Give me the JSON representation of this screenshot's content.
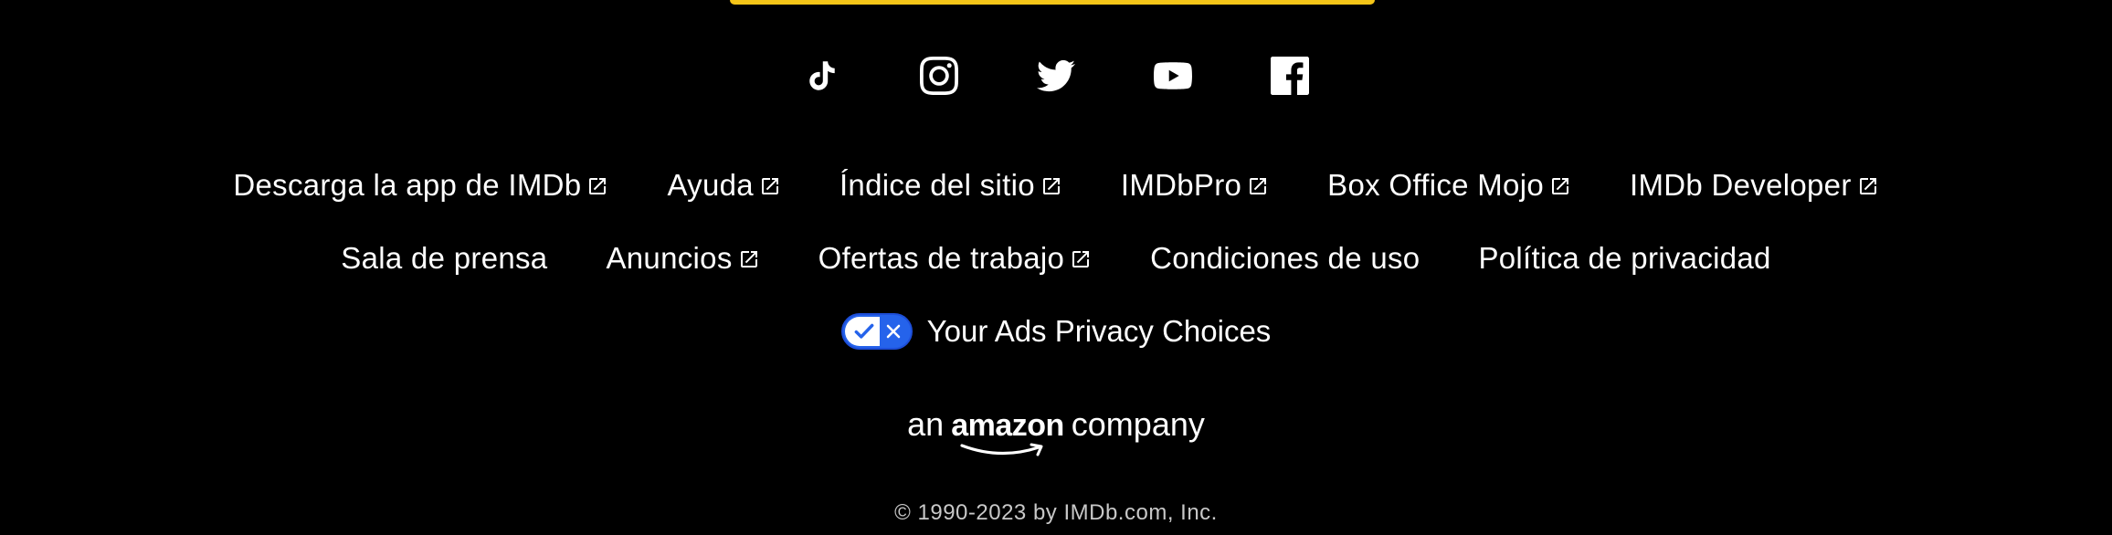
{
  "accent_color": "#f5c518",
  "privacy_toggle_color": "#2563eb",
  "social": [
    {
      "name": "tiktok-icon"
    },
    {
      "name": "instagram-icon"
    },
    {
      "name": "twitter-icon"
    },
    {
      "name": "youtube-icon"
    },
    {
      "name": "facebook-icon"
    }
  ],
  "links_row1": [
    {
      "label": "Descarga la app de IMDb",
      "external": true
    },
    {
      "label": "Ayuda",
      "external": true
    },
    {
      "label": "Índice del sitio",
      "external": true
    },
    {
      "label": "IMDbPro",
      "external": true
    },
    {
      "label": "Box Office Mojo",
      "external": true
    },
    {
      "label": "IMDb Developer",
      "external": true
    }
  ],
  "links_row2": [
    {
      "label": "Sala de prensa",
      "external": false
    },
    {
      "label": "Anuncios",
      "external": true
    },
    {
      "label": "Ofertas de trabajo",
      "external": true
    },
    {
      "label": "Condiciones de uso",
      "external": false
    },
    {
      "label": "Política de privacidad",
      "external": false
    }
  ],
  "privacy": {
    "label": "Your Ads Privacy Choices"
  },
  "amazon": {
    "prefix": "an",
    "brand": "amazon",
    "suffix": "company"
  },
  "copyright": "© 1990-2023 by IMDb.com, Inc."
}
